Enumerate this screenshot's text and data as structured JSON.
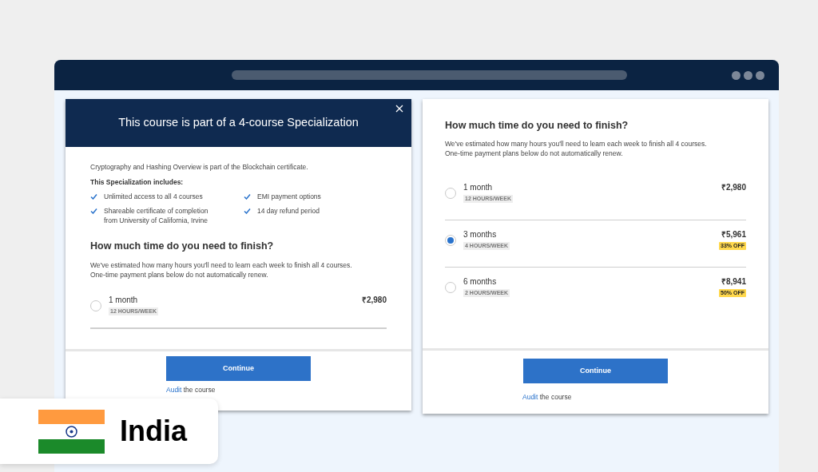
{
  "left_modal": {
    "title": "This course is part of a 4-course Specialization",
    "intro": "Cryptography and Hashing Overview is part of the Blockchain certificate.",
    "includes_heading": "This Specialization includes:",
    "features": [
      "Unlimited access to all 4 courses",
      "EMI payment options",
      "Shareable certificate of completion from University of California, Irvine",
      "14 day refund period"
    ],
    "plan_heading": "How much time do you need to finish?",
    "plan_note": "We've estimated how many hours you'll need to learn each week to finish all 4 courses. One-time payment plans below do not automatically renew.",
    "plans": [
      {
        "duration": "1 month",
        "hours": "12 HOURS/WEEK",
        "price": "₹2,980",
        "selected": false
      }
    ],
    "continue_button": "Continue",
    "audit_link": "Audit",
    "audit_text": "the course"
  },
  "right_card": {
    "plan_heading": "How much time do you need to finish?",
    "plan_note": "We've estimated how many hours you'll need to learn each week to finish all 4 courses. One-time payment plans below do not automatically renew.",
    "plans": [
      {
        "duration": "1 month",
        "hours": "12 HOURS/WEEK",
        "price": "₹2,980",
        "selected": false
      },
      {
        "duration": "3 months",
        "hours": "4 HOURS/WEEK",
        "price": "₹5,961",
        "discount": "33% OFF",
        "selected": true
      },
      {
        "duration": "6 months",
        "hours": "2 HOURS/WEEK",
        "price": "₹8,941",
        "discount": "50% OFF",
        "selected": false
      }
    ],
    "continue_button": "Continue",
    "audit_link": "Audit",
    "audit_text": "the course"
  },
  "country_badge": {
    "label": "India"
  }
}
